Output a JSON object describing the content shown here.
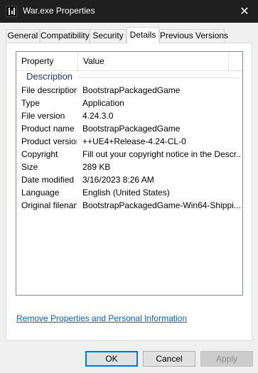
{
  "window": {
    "title": "War.exe Properties",
    "close_glyph": "✕",
    "icon": "app-icon"
  },
  "tabs": [
    {
      "label": "General",
      "active": false
    },
    {
      "label": "Compatibility",
      "active": false
    },
    {
      "label": "Security",
      "active": false
    },
    {
      "label": "Details",
      "active": true
    },
    {
      "label": "Previous Versions",
      "active": false
    }
  ],
  "details": {
    "columns": {
      "property": "Property",
      "value": "Value"
    },
    "group": "Description",
    "rows": [
      {
        "property": "File description",
        "value": "BootstrapPackagedGame"
      },
      {
        "property": "Type",
        "value": "Application"
      },
      {
        "property": "File version",
        "value": "4.24.3.0"
      },
      {
        "property": "Product name",
        "value": "BootstrapPackagedGame"
      },
      {
        "property": "Product version",
        "value": "++UE4+Release-4.24-CL-0"
      },
      {
        "property": "Copyright",
        "value": "Fill out your copyright notice in the Descr..."
      },
      {
        "property": "Size",
        "value": "289 KB"
      },
      {
        "property": "Date modified",
        "value": "3/16/2023 8:26 AM"
      },
      {
        "property": "Language",
        "value": "English (United States)"
      },
      {
        "property": "Original filename",
        "value": "BootstrapPackagedGame-Win64-Shippi..."
      }
    ]
  },
  "remove_link": "Remove Properties and Personal Information",
  "buttons": {
    "ok": "OK",
    "cancel": "Cancel",
    "apply": "Apply"
  },
  "colors": {
    "titlebar": "#1f1f1f",
    "group_header": "#1e3287",
    "link": "#0066cc",
    "default_button_border": "#0078d7"
  }
}
